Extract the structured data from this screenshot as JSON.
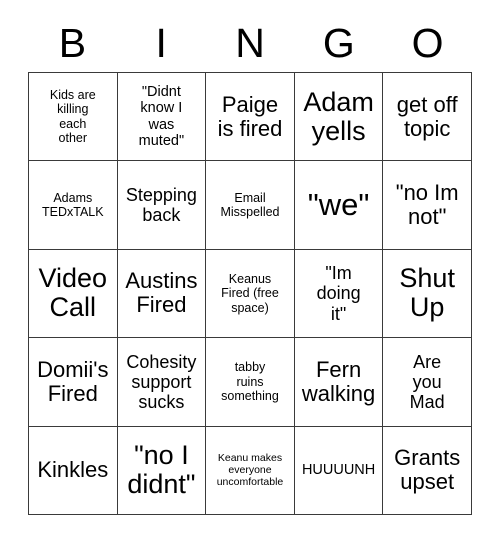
{
  "card": {
    "header_letters": [
      "B",
      "I",
      "N",
      "G",
      "O"
    ],
    "rows": [
      [
        {
          "text": "Kids are\nkilling\neach\nother",
          "size": "xs"
        },
        {
          "text": "\"Didnt\nknow I\nwas\nmuted\"",
          "size": "sm"
        },
        {
          "text": "Paige\nis fired",
          "size": "lg"
        },
        {
          "text": "Adam\nyells",
          "size": "xl"
        },
        {
          "text": "get off\ntopic",
          "size": "lg"
        }
      ],
      [
        {
          "text": "Adams\nTEDxTALK",
          "size": "xs"
        },
        {
          "text": "Stepping\nback",
          "size": "md"
        },
        {
          "text": "Email\nMisspelled",
          "size": "xs"
        },
        {
          "text": "\"we\"",
          "size": "xxl"
        },
        {
          "text": "\"no Im\nnot\"",
          "size": "lg"
        }
      ],
      [
        {
          "text": "Video\nCall",
          "size": "xl"
        },
        {
          "text": "Austins\nFired",
          "size": "lg"
        },
        {
          "text": "Keanus\nFired (free\nspace)",
          "size": "xs"
        },
        {
          "text": "\"Im\ndoing\nit\"",
          "size": "md"
        },
        {
          "text": "Shut\nUp",
          "size": "xl"
        }
      ],
      [
        {
          "text": "Domii's\nFired",
          "size": "lg"
        },
        {
          "text": "Cohesity\nsupport\nsucks",
          "size": "md"
        },
        {
          "text": "tabby\nruins\nsomething",
          "size": "xs"
        },
        {
          "text": "Fern\nwalking",
          "size": "lg"
        },
        {
          "text": "Are\nyou\nMad",
          "size": "md"
        }
      ],
      [
        {
          "text": "Kinkles",
          "size": "lg"
        },
        {
          "text": "\"no I\ndidnt\"",
          "size": "xl"
        },
        {
          "text": "Keanu makes\neveryone\nuncomfortable",
          "size": "xxs"
        },
        {
          "text": "HUUUUNH",
          "size": "sm"
        },
        {
          "text": "Grants\nupset",
          "size": "lg"
        }
      ]
    ]
  },
  "colors": {
    "background": "#ffffff",
    "text": "#000000",
    "border": "#3a3a3a"
  }
}
